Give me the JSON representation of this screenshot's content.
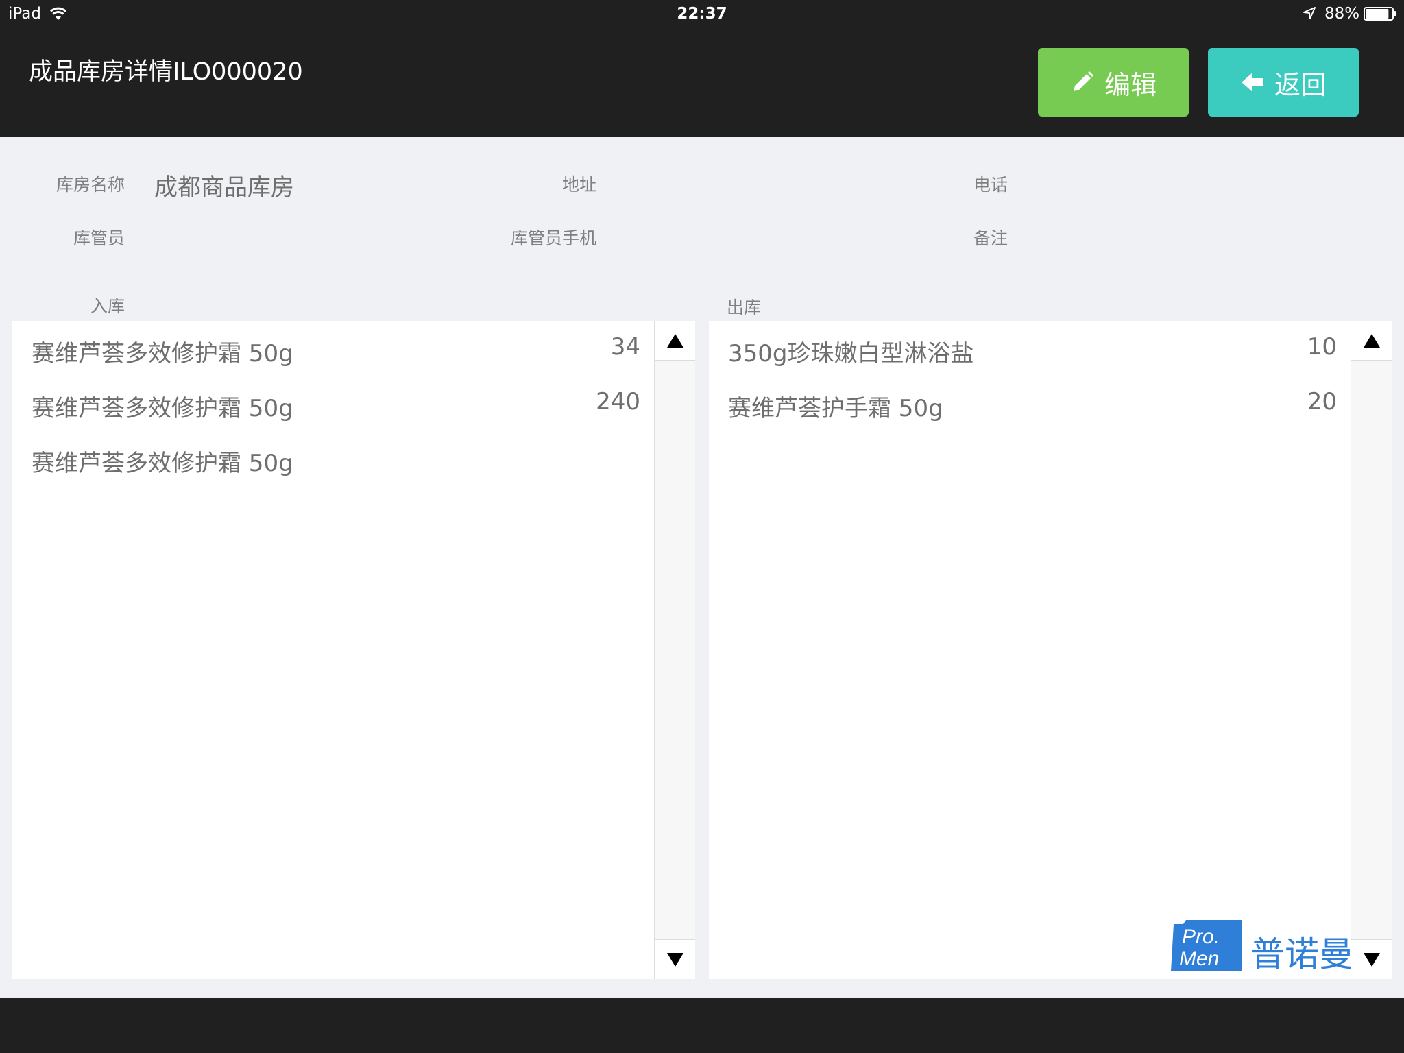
{
  "status_bar": {
    "device": "iPad",
    "time": "22:37",
    "battery": "88%",
    "battery_level": 0.88
  },
  "header": {
    "title": "成品库房详情ILO000020",
    "edit_label": "编辑",
    "back_label": "返回",
    "edit_color": "#77cb52",
    "back_color": "#3ccbbf"
  },
  "info": {
    "name_label": "库房名称",
    "name_value": "成都商品库房",
    "address_label": "地址",
    "address_value": "",
    "phone_label": "电话",
    "phone_value": "",
    "keeper_label": "库管员",
    "keeper_value": "",
    "keeper_phone_label": "库管员手机",
    "keeper_phone_value": "",
    "note_label": "备注",
    "note_value": ""
  },
  "inbound": {
    "label": "入库",
    "rows": [
      {
        "name": "赛维芦荟多效修护霜 50g",
        "qty": "34"
      },
      {
        "name": "赛维芦荟多效修护霜 50g",
        "qty": "240"
      },
      {
        "name": "赛维芦荟多效修护霜 50g",
        "qty": ""
      }
    ]
  },
  "outbound": {
    "label": "出库",
    "rows": [
      {
        "name": "350g珍珠嫩白型淋浴盐",
        "qty": "10"
      },
      {
        "name": "赛维芦荟护手霜 50g",
        "qty": "20"
      }
    ]
  },
  "logo": {
    "line1": "Pro.",
    "line2": "Men",
    "text": "普诺曼"
  }
}
